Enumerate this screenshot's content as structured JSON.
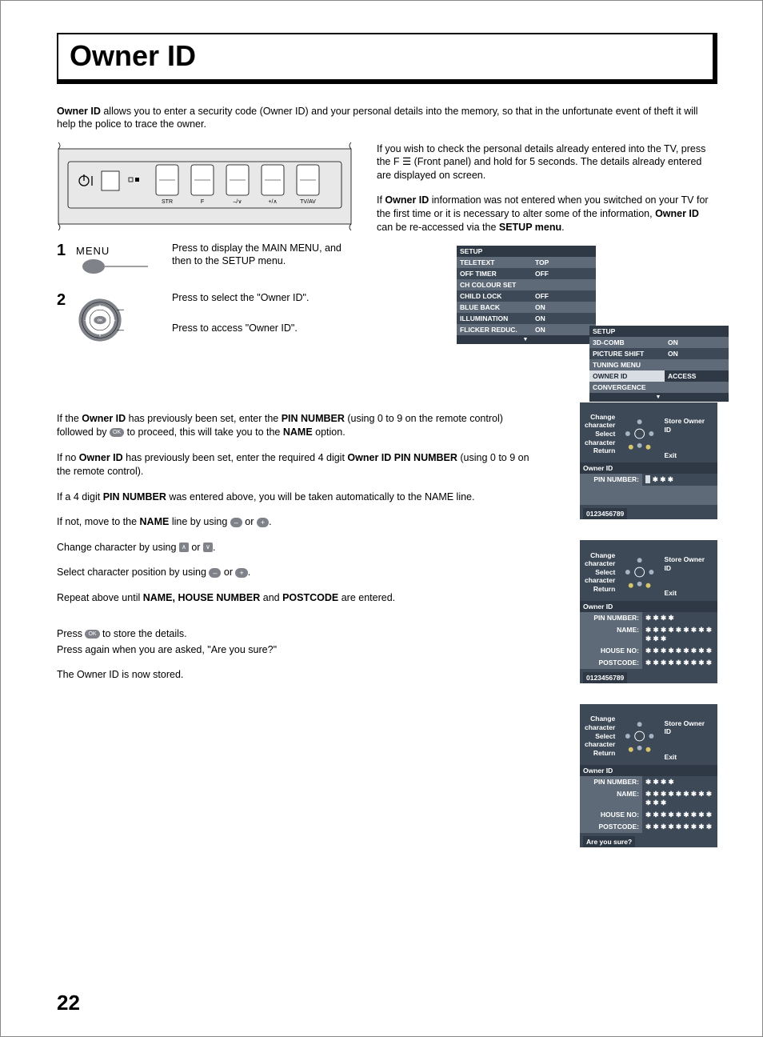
{
  "title": "Owner ID",
  "intro_prefix_bold": "Owner ID",
  "intro_rest": " allows you to enter a security code (Owner ID) and your personal details into the memory, so that in the unfortunate event of theft it will help the police to trace the owner.",
  "panel_labels": {
    "str": "STR",
    "f": "F",
    "down": "–/∨",
    "up": "+/∧",
    "tvav": "TV/AV"
  },
  "step1_num": "1",
  "step1_menu": "MENU",
  "step1_text": "Press to display the MAIN MENU, and then to the SETUP menu.",
  "step2_num": "2",
  "step2_text1": "Press to select the \"Owner ID\".",
  "step2_text2": "Press to access \"Owner ID\".",
  "right_p1": "If you wish to check the personal details already entered into the TV, press the F ☰ (Front panel) and hold for 5 seconds. The details already entered are displayed on screen.",
  "right_p2_a": "If ",
  "right_p2_b": "Owner ID",
  "right_p2_c": " information was not entered when you switched on your TV for the first time or it is necessary to alter some of the information, ",
  "right_p2_d": "Owner ID",
  "right_p2_e": " can be re-accessed via the ",
  "right_p2_f": "SETUP menu",
  "right_p2_g": ".",
  "setup1": {
    "header": "SETUP",
    "rows": [
      {
        "label": "TELETEXT",
        "value": "TOP"
      },
      {
        "label": "OFF TIMER",
        "value": "OFF"
      },
      {
        "label": "CH COLOUR SET",
        "value": ""
      },
      {
        "label": "CHILD LOCK",
        "value": "OFF"
      },
      {
        "label": "BLUE BACK",
        "value": "ON"
      },
      {
        "label": "ILLUMINATION",
        "value": "ON"
      },
      {
        "label": "FLICKER REDUC.",
        "value": "ON"
      }
    ]
  },
  "setup2": {
    "header": "SETUP",
    "rows": [
      {
        "label": "3D-COMB",
        "value": "ON"
      },
      {
        "label": "PICTURE SHIFT",
        "value": "ON"
      },
      {
        "label": "TUNING MENU",
        "value": ""
      },
      {
        "label": "OWNER ID",
        "value": "ACCESS",
        "hl": true
      },
      {
        "label": "CONVERGENCE",
        "value": ""
      }
    ]
  },
  "legend": {
    "change": "Change",
    "character": "character",
    "select": "Select",
    "store": "Store Owner ID",
    "return": "Return",
    "exit": "Exit"
  },
  "osd_owner": "Owner ID",
  "fields": {
    "pin": "PIN NUMBER:",
    "name": "NAME:",
    "house": "HOUSE NO:",
    "postcode": "POSTCODE:"
  },
  "pin_masked3": "✱ ✱ ✱",
  "pin_masked4": "✱ ✱ ✱ ✱",
  "stars12": "✱ ✱ ✱ ✱ ✱ ✱ ✱ ✱ ✱ ✱ ✱ ✱",
  "stars9": "✱ ✱ ✱ ✱ ✱ ✱ ✱ ✱ ✱",
  "numstrip": "0123456789",
  "are_you_sure": "Are you sure?",
  "body": {
    "p1a": "If the ",
    "p1b": "Owner ID",
    "p1c": " has previously been set, enter the ",
    "p1d": "PIN NUMBER",
    "p1e": " (using 0 to 9 on the remote control) followed by ",
    "p1f": " to proceed, this will take you to the ",
    "p1g": "NAME",
    "p1h": " option.",
    "p2a": "If no ",
    "p2b": "Owner ID",
    "p2c": " has previously been set, enter the required 4 digit ",
    "p2d": "Owner ID PIN NUMBER",
    "p2e": " (using 0 to 9 on the remote control).",
    "p3a": "If a 4 digit ",
    "p3b": "PIN NUMBER",
    "p3c": " was entered above, you will be taken automatically to the NAME line.",
    "p4a": "If not, move to the ",
    "p4b": "NAME",
    "p4c": " line by using ",
    "p4d": " or ",
    "p4e": ".",
    "p5a": "Change character by using ",
    "p5b": " or ",
    "p5c": ".",
    "p6a": "Select character position by using ",
    "p6b": " or ",
    "p6c": ".",
    "p7a": "Repeat above until ",
    "p7b": "NAME, HOUSE NUMBER",
    "p7c": " and ",
    "p7d": "POSTCODE",
    "p7e": " are entered.",
    "p8a": "Press ",
    "p8b": " to store the details.",
    "p9": "Press again when you are asked, \"Are you sure?\"",
    "p10": "The Owner ID is now stored."
  },
  "btn": {
    "minus": "–",
    "plus": "+",
    "up": "∧",
    "down": "∨",
    "ok": "OK"
  },
  "page_number": "22"
}
